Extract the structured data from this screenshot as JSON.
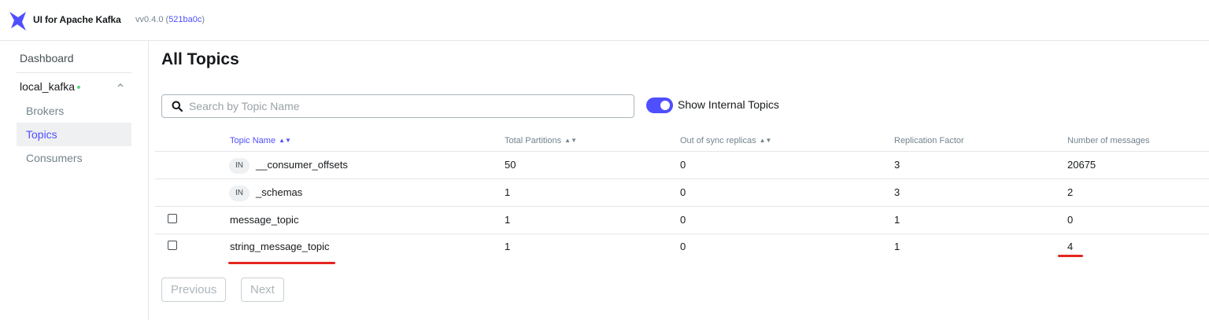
{
  "app": {
    "brand": "UI for Apache Kafka",
    "version_prefix": "vv0.4.0 (",
    "commit": "521ba0c",
    "version_suffix": ")",
    "accent_color": "#4f4fff"
  },
  "sidebar": {
    "dashboard_label": "Dashboard",
    "cluster_name": "local_kafka",
    "cluster_status_color": "#5cd685",
    "items": [
      {
        "label": "Brokers",
        "active": false
      },
      {
        "label": "Topics",
        "active": true
      },
      {
        "label": "Consumers",
        "active": false
      }
    ]
  },
  "main": {
    "title": "All Topics",
    "search_placeholder": "Search by Topic Name",
    "toggle_label": "Show Internal Topics",
    "toggle_on": true
  },
  "table": {
    "columns": [
      {
        "label": "Topic Name",
        "sort_icon": "sort-icon",
        "sorted": true
      },
      {
        "label": "Total Partitions",
        "sort_icon": "sort-icon",
        "sorted": false
      },
      {
        "label": "Out of sync replicas",
        "sort_icon": "sort-icon",
        "sorted": false
      },
      {
        "label": "Replication Factor"
      },
      {
        "label": "Number of messages"
      }
    ],
    "rows": [
      {
        "internal_badge": "IN",
        "name": "__consumer_offsets",
        "partitions": "50",
        "out_of_sync": "0",
        "replication": "3",
        "messages": "20675"
      },
      {
        "internal_badge": "IN",
        "name": "_schemas",
        "partitions": "1",
        "out_of_sync": "0",
        "replication": "3",
        "messages": "2"
      },
      {
        "internal_badge": "",
        "name": "message_topic",
        "partitions": "1",
        "out_of_sync": "0",
        "replication": "1",
        "messages": "0"
      },
      {
        "internal_badge": "",
        "name": "string_message_topic",
        "partitions": "1",
        "out_of_sync": "0",
        "replication": "1",
        "messages": "4"
      }
    ]
  },
  "pagination": {
    "previous_label": "Previous",
    "next_label": "Next"
  },
  "annotation_color": "#e5251f"
}
